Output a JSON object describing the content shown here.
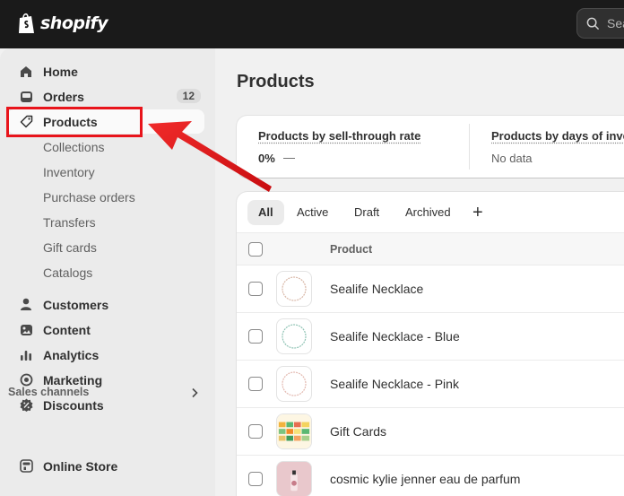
{
  "brand": {
    "name": "shopify"
  },
  "search": {
    "placeholder": "Sea"
  },
  "sidebar": {
    "home": "Home",
    "orders": "Orders",
    "orders_badge": "12",
    "products": "Products",
    "product_sub": [
      "Collections",
      "Inventory",
      "Purchase orders",
      "Transfers",
      "Gift cards",
      "Catalogs"
    ],
    "customers": "Customers",
    "content": "Content",
    "analytics": "Analytics",
    "marketing": "Marketing",
    "discounts": "Discounts",
    "sales_channels_label": "Sales channels",
    "online_store": "Online Store"
  },
  "main": {
    "title": "Products",
    "metrics": {
      "metric1_title": "Products by sell-through rate",
      "metric1_value": "0%",
      "metric1_dash": "—",
      "metric2_title": "Products by days of inve",
      "metric2_value": "No data"
    },
    "tabs": [
      "All",
      "Active",
      "Draft",
      "Archived"
    ],
    "add_tab": "+",
    "table_header": {
      "product": "Product"
    },
    "rows": [
      {
        "name": "Sealife Necklace"
      },
      {
        "name": "Sealife Necklace - Blue"
      },
      {
        "name": "Sealife Necklace - Pink"
      },
      {
        "name": "Gift Cards"
      },
      {
        "name": "cosmic kylie jenner eau de parfum"
      }
    ]
  },
  "colors": {
    "topbar": "#1a1a1a",
    "highlight": "#e8141b",
    "sidebar_bg": "#ebebeb",
    "page_bg": "#f1f1f1"
  },
  "icons": {
    "home": "home-icon",
    "orders": "inbox-icon",
    "products": "tag-icon",
    "customers": "person-icon",
    "content": "image-icon",
    "analytics": "bar-chart-icon",
    "marketing": "target-icon",
    "discounts": "discount-icon",
    "online_store": "store-icon",
    "search": "search-icon"
  }
}
